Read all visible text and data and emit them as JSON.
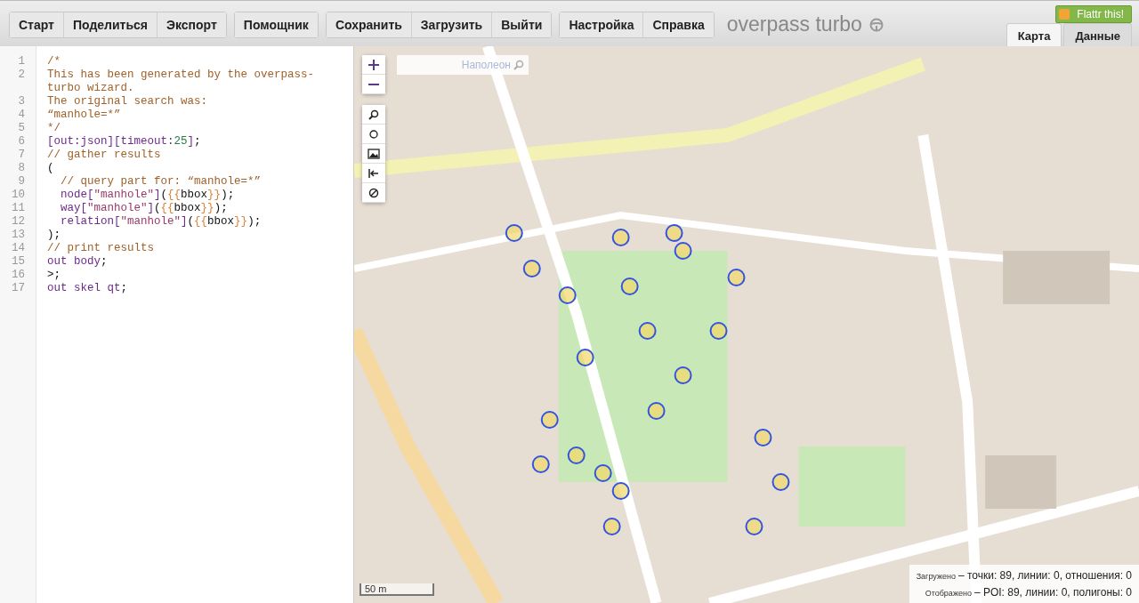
{
  "toolbar": {
    "groups": [
      [
        "Старт",
        "Поделиться",
        "Экспорт"
      ],
      [
        "Помощник"
      ],
      [
        "Сохранить",
        "Загрузить",
        "Выйти"
      ],
      [
        "Настройка",
        "Справка"
      ]
    ],
    "title": "overpass turbo",
    "flattr": "Flattr this!",
    "tabs": [
      {
        "label": "Карта",
        "selected": true
      },
      {
        "label": "Данные",
        "selected": false
      }
    ]
  },
  "editor": {
    "lines": [
      {
        "number": "1",
        "tokens": [
          {
            "kind": "comment",
            "text": "/*"
          }
        ]
      },
      {
        "number": "2",
        "tokens": [
          {
            "kind": "comment",
            "text": "This has been generated by the overpass-turbo wizard."
          }
        ]
      },
      {
        "number": "3",
        "tokens": [
          {
            "kind": "comment",
            "text": "The original search was:"
          }
        ]
      },
      {
        "number": "4",
        "tokens": [
          {
            "kind": "comment",
            "text": "“manhole=*”"
          }
        ]
      },
      {
        "number": "5",
        "tokens": [
          {
            "kind": "comment",
            "text": "*/"
          }
        ]
      },
      {
        "number": "6",
        "tokens": [
          {
            "kind": "keyword",
            "text": "[out:json][timeout:"
          },
          {
            "kind": "number",
            "text": "25"
          },
          {
            "kind": "keyword",
            "text": "]"
          },
          {
            "kind": "plain",
            "text": ";"
          }
        ]
      },
      {
        "number": "7",
        "tokens": [
          {
            "kind": "comment",
            "text": "// gather results"
          }
        ]
      },
      {
        "number": "8",
        "tokens": [
          {
            "kind": "plain",
            "text": "("
          }
        ]
      },
      {
        "number": "9",
        "tokens": [
          {
            "kind": "comment",
            "text": "  // query part for: “manhole=*”"
          }
        ]
      },
      {
        "number": "10",
        "tokens": [
          {
            "kind": "keyword",
            "text": "  node["
          },
          {
            "kind": "string",
            "text": "\"manhole\""
          },
          {
            "kind": "keyword",
            "text": "]"
          },
          {
            "kind": "plain",
            "text": "("
          },
          {
            "kind": "brace",
            "text": "{{"
          },
          {
            "kind": "plain",
            "text": "bbox"
          },
          {
            "kind": "brace",
            "text": "}}"
          },
          {
            "kind": "plain",
            "text": ");"
          }
        ]
      },
      {
        "number": "11",
        "tokens": [
          {
            "kind": "keyword",
            "text": "  way["
          },
          {
            "kind": "string",
            "text": "\"manhole\""
          },
          {
            "kind": "keyword",
            "text": "]"
          },
          {
            "kind": "plain",
            "text": "("
          },
          {
            "kind": "brace",
            "text": "{{"
          },
          {
            "kind": "plain",
            "text": "bbox"
          },
          {
            "kind": "brace",
            "text": "}}"
          },
          {
            "kind": "plain",
            "text": ");"
          }
        ]
      },
      {
        "number": "12",
        "tokens": [
          {
            "kind": "keyword",
            "text": "  relation["
          },
          {
            "kind": "string",
            "text": "\"manhole\""
          },
          {
            "kind": "keyword",
            "text": "]"
          },
          {
            "kind": "plain",
            "text": "("
          },
          {
            "kind": "brace",
            "text": "{{"
          },
          {
            "kind": "plain",
            "text": "bbox"
          },
          {
            "kind": "brace",
            "text": "}}"
          },
          {
            "kind": "plain",
            "text": ");"
          }
        ]
      },
      {
        "number": "13",
        "tokens": [
          {
            "kind": "plain",
            "text": ");"
          }
        ]
      },
      {
        "number": "14",
        "tokens": [
          {
            "kind": "comment",
            "text": "// print results"
          }
        ]
      },
      {
        "number": "15",
        "tokens": [
          {
            "kind": "keyword",
            "text": "out body"
          },
          {
            "kind": "plain",
            "text": ";"
          }
        ]
      },
      {
        "number": "16",
        "tokens": [
          {
            "kind": "plain",
            "text": ">;"
          }
        ]
      },
      {
        "number": "17",
        "tokens": [
          {
            "kind": "keyword",
            "text": "out skel qt"
          },
          {
            "kind": "plain",
            "text": ";"
          }
        ]
      }
    ]
  },
  "map": {
    "search": {
      "placeholder": "Наполеон"
    },
    "scale": "50 m",
    "stats": [
      {
        "label": "Загружено",
        "value": "– точки: 89, линии: 0, отношения: 0"
      },
      {
        "label": "Отображено",
        "value": "– POI: 89, линии: 0, полигоны: 0"
      }
    ]
  }
}
